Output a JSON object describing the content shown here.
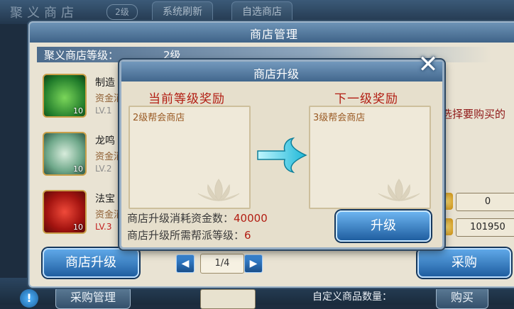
{
  "background": {
    "title": "聚义商店",
    "level_badge": "2级",
    "tabs": [
      "系统刷新",
      "自选商店"
    ],
    "bottom_buttons": [
      "采购管理",
      "购买"
    ],
    "qty_label": "自定义商品数量："
  },
  "outer_window": {
    "title": "商店管理",
    "shop_level_label": "聚义商店等级：",
    "shop_level_value": "2级",
    "items": [
      {
        "name": "制造",
        "sub": "资金消",
        "level": "LV.1",
        "count": "10",
        "icon": "green-pouch-icon"
      },
      {
        "name": "龙鸣",
        "sub": "资金消",
        "level": "LV.2",
        "count": "10",
        "icon": "jade-flute-icon"
      },
      {
        "name": "法宝",
        "sub": "资金消",
        "level": "LV.3",
        "count": "10",
        "icon": "red-bag-icon"
      }
    ],
    "hint_text": "选择要购买的",
    "values": [
      "0",
      "101950"
    ],
    "upgrade_shop_button": "商店升级",
    "purchase_button": "采购",
    "page_indicator": "1/4",
    "prev_icon": "triangle-left-icon",
    "next_icon": "triangle-right-icon"
  },
  "modal": {
    "title": "商店升级",
    "current_heading": "当前等级奖励",
    "next_heading": "下一级奖励",
    "current_reward": "2级帮会商店",
    "next_reward": "3级帮会商店",
    "cost_label": "商店升级消耗资金数：",
    "cost_value": "40000",
    "guild_label": "商店升级所需帮派等级：",
    "guild_value": "6",
    "upgrade_button": "升级",
    "close_icon": "close-x-icon",
    "arrow_icon": "cyan-arrow-right-icon"
  },
  "colors": {
    "heading_red": "#b21d12",
    "reward_brown": "#9a5a24",
    "button_blue": "#1f5ea0",
    "panel_beige": "#e6dfcc"
  }
}
